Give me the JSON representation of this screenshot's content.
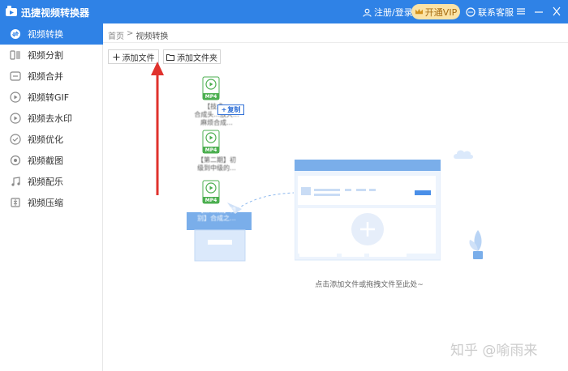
{
  "app": {
    "title": "迅捷视频转换器"
  },
  "titlebar": {
    "login_label": "注册/登录",
    "vip_label": "开通VIP",
    "support_label": "联系客服"
  },
  "sidebar": {
    "items": [
      {
        "label": "视频转换",
        "icon": "convert-icon",
        "active": true
      },
      {
        "label": "视频分割",
        "icon": "split-icon"
      },
      {
        "label": "视频合并",
        "icon": "merge-icon"
      },
      {
        "label": "视频转GIF",
        "icon": "gif-icon"
      },
      {
        "label": "视频去水印",
        "icon": "watermark-remove-icon"
      },
      {
        "label": "视频优化",
        "icon": "optimize-icon"
      },
      {
        "label": "视频截图",
        "icon": "screenshot-icon"
      },
      {
        "label": "视频配乐",
        "icon": "music-icon"
      },
      {
        "label": "视频压缩",
        "icon": "compress-icon"
      }
    ]
  },
  "breadcrumb": {
    "home": "首页",
    "separator": ">",
    "current": "视频转换"
  },
  "toolbar": {
    "add_file": "添加文件",
    "add_folder": "添加文件夹"
  },
  "drag_files": [
    {
      "badge": "MP4",
      "name_line1": "【技术...",
      "name_line2": "合成头...放大...",
      "name_line3": "麻烦合成..."
    },
    {
      "badge": "MP4",
      "name_line1": "【第二期】初",
      "name_line2": "级到中级的..."
    },
    {
      "badge": "MP4",
      "name_line1": "【第三期】特",
      "name_line2": "别】合成之..."
    }
  ],
  "copy_tooltip": "复制",
  "drop_hint": "点击添加文件或拖拽文件至此处~",
  "watermark": "知乎 @喻雨来",
  "colors": {
    "accent": "#2f82e6",
    "arrow": "#e0322d",
    "file_green": "#4caf50"
  }
}
